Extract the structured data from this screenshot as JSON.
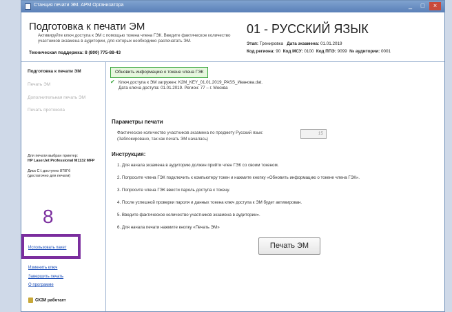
{
  "window": {
    "title": "Станция печати ЭМ. АРМ Организатора",
    "controls": [
      "_",
      "□",
      "×"
    ]
  },
  "header": {
    "app_title": "Подготовка к печати ЭМ",
    "description": "Активируйте ключ доступа к ЭМ с помощью токена члена ГЭК. Введите фактическое количество участников экзамена в аудитории, для которых необходимо распечатать ЭМ.",
    "support_label": "Техническая поддержка:",
    "support_phone": "8 (800) 775-88-43",
    "subject": "01 - РУССКИЙ ЯЗЫК",
    "stage_label": "Этап:",
    "stage_value": "Тренировка",
    "exam_date_label": "Дата экзамена:",
    "exam_date_value": "01.01.2019",
    "region_label": "Код региона:",
    "region_value": "90",
    "msu_label": "Код МСУ:",
    "msu_value": "0100",
    "ppe_label": "Код ППЭ:",
    "ppe_value": "9099",
    "room_label": "№ аудитории:",
    "room_value": "0001"
  },
  "sidebar": {
    "items": [
      {
        "label": "Подготовка к печати ЭМ",
        "state": "active"
      },
      {
        "label": "Печать ЭМ",
        "state": "disabled"
      },
      {
        "label": "Дополнительная печать ЭМ",
        "state": "disabled"
      },
      {
        "label": "Печать протокола",
        "state": "disabled"
      }
    ],
    "printer_label": "Для печати выбран принтер:",
    "printer_name": "HP LaserJet Professional M1132 MFP",
    "disk_line1": "Диск C:\\ доступно 879Гб",
    "disk_line2": "(достаточно для печати)",
    "marker_number": "8",
    "links": [
      "Использовать пакет",
      "Изменить ключ",
      "Завершить печать",
      "О программе"
    ],
    "ckzi_status": "СКЗИ работает"
  },
  "main": {
    "refresh_button": "Обновить информацию о токене члена ГЭК",
    "key_loaded_line": "Ключ доступа к ЭМ загружен: K2M_KEY_01.01.2019_PASS_Иванова.dat.",
    "key_meta_line": "Дата ключа доступа: 01.01.2019. Регион: 77 – г. Москва",
    "params_title": "Параметры печати",
    "param_label": "Фактическое количество участников экзамена по предмету Русский язык:",
    "param_note": "(Заблокировано, так как печать ЭМ началась)",
    "param_value": "15",
    "instructions_title": "Инструкция:",
    "instructions": [
      "1. Для начала экзамена в аудиторию должен прийти член ГЭК со своим токеном.",
      "2. Попросите члена ГЭК подключить к компьютеру токен и нажмите кнопку «Обновить информацию о токене члена ГЭК».",
      "3. Попросите члена ГЭК ввести пароль доступа к токену.",
      "4. После успешной проверки пароля и данных токена ключ доступа к ЭМ будет активирован.",
      "5. Введите фактическое количество участников экзамена в аудитории».",
      "6. Для начала печати нажмите кнопку «Печать ЭМ»"
    ],
    "print_button": "Печать ЭМ"
  },
  "colors": {
    "accent": "#5a80b8",
    "highlight": "#7b2e9e",
    "success": "#39a53c",
    "link": "#1d4fb8"
  }
}
